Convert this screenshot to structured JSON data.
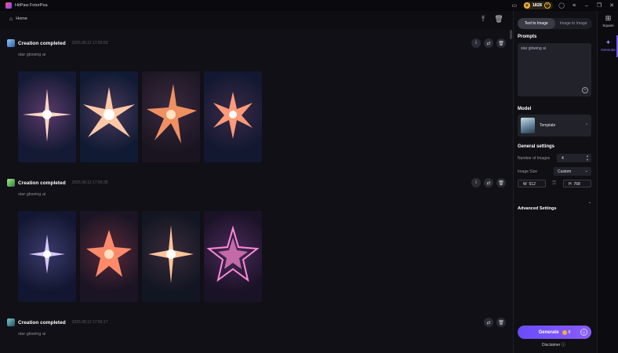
{
  "app": {
    "title": "HitPaw FotorPea"
  },
  "titlebar": {
    "credits": "1828",
    "credit_plus": "+",
    "coin_icon": "coin-icon",
    "icons": [
      "monitor-icon",
      "coin-icon",
      "user-icon",
      "menu-icon",
      "minimize-icon",
      "restore-icon",
      "close-icon"
    ]
  },
  "nav": {
    "home_label": "Home"
  },
  "feed": {
    "cards": [
      {
        "title": "Creation completed",
        "date": "2025.08.12   17:56:55",
        "prompt": "star glowing ai",
        "actions": [
          "info-icon",
          "regenerate-icon",
          "delete-icon"
        ]
      },
      {
        "title": "Creation completed",
        "date": "2025.08.12   17:56:35",
        "prompt": "star glowing ai",
        "actions": [
          "info-icon",
          "regenerate-icon",
          "delete-icon"
        ]
      },
      {
        "title": "Creation completed",
        "date": "2025.08.12   17:56:17",
        "prompt": "star glowing ai",
        "actions": [
          "regenerate-icon",
          "delete-icon"
        ]
      }
    ]
  },
  "panel": {
    "tabs": [
      "Text to Image",
      "Image to Image"
    ],
    "active_tab": "Text to Image",
    "prompts_title": "Prompts",
    "prompt_value": "star glowing ai",
    "model_title": "Model",
    "model_name": "Template",
    "general_title": "General settings",
    "num_images_label": "Number of Images",
    "num_images_value": "4",
    "image_size_label": "Image Size",
    "image_size_value": "Custom",
    "width_label": "W",
    "width_value": "512",
    "height_label": "H",
    "height_value": "768",
    "advanced_label": "Advanced Settings",
    "generate_label": "Generate",
    "generate_cost": "8",
    "disclaimer": "Disclaimer"
  },
  "rail": {
    "items": [
      {
        "label": "Square",
        "icon": "grid-icon"
      },
      {
        "label": "Generate",
        "icon": "sparkle-icon"
      }
    ],
    "active": "Generate"
  },
  "colors": {
    "accent": "#7a5cff",
    "background": "#0d0d12",
    "coin": "#f0b13a"
  }
}
